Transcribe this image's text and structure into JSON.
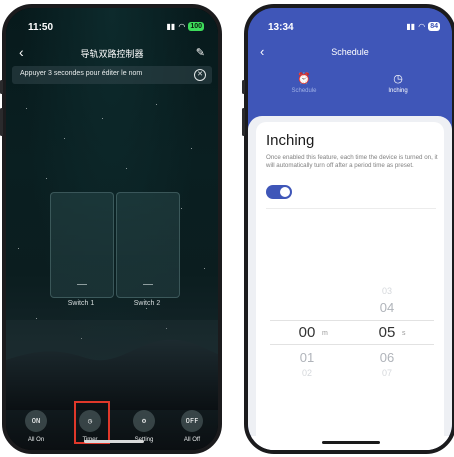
{
  "phone1": {
    "status_bar": {
      "time": "11:50",
      "battery": "100"
    },
    "nav": {
      "title": "导轨双路控制器"
    },
    "banner": {
      "text": "Appuyer 3 secondes pour éditer le nom"
    },
    "switches": [
      {
        "label": "Switch 1"
      },
      {
        "label": "Switch 2"
      }
    ],
    "controls": [
      {
        "icon_text": "ON",
        "label": "All On",
        "icon": "on-text-icon"
      },
      {
        "icon_text": "◷",
        "label": "Timer",
        "icon": "clock-icon"
      },
      {
        "icon_text": "⚙",
        "label": "Setting",
        "icon": "gear-icon"
      },
      {
        "icon_text": "OFF",
        "label": "All Off",
        "icon": "off-text-icon"
      }
    ],
    "highlight_color": "#e0382a"
  },
  "phone2": {
    "status_bar": {
      "time": "13:34",
      "battery": "84"
    },
    "nav": {
      "title": "Schedule"
    },
    "tabs": [
      {
        "label": "Schedule",
        "icon": "alarm-clock-icon",
        "active": false
      },
      {
        "label": "Inching",
        "icon": "clock-icon",
        "active": true
      }
    ],
    "inching": {
      "title": "Inching",
      "description": "Once enabled this feature, each time the device is turned on, it will automatically turn off after a period time as preset.",
      "enabled": true
    },
    "picker": {
      "minutes": {
        "selected": "00",
        "unit": "m",
        "after": [
          "01",
          "02"
        ]
      },
      "seconds": {
        "selected": "05",
        "unit": "s",
        "before": [
          "03",
          "04"
        ],
        "after": [
          "06",
          "07"
        ]
      }
    },
    "accent_color": "#3f56b8"
  }
}
